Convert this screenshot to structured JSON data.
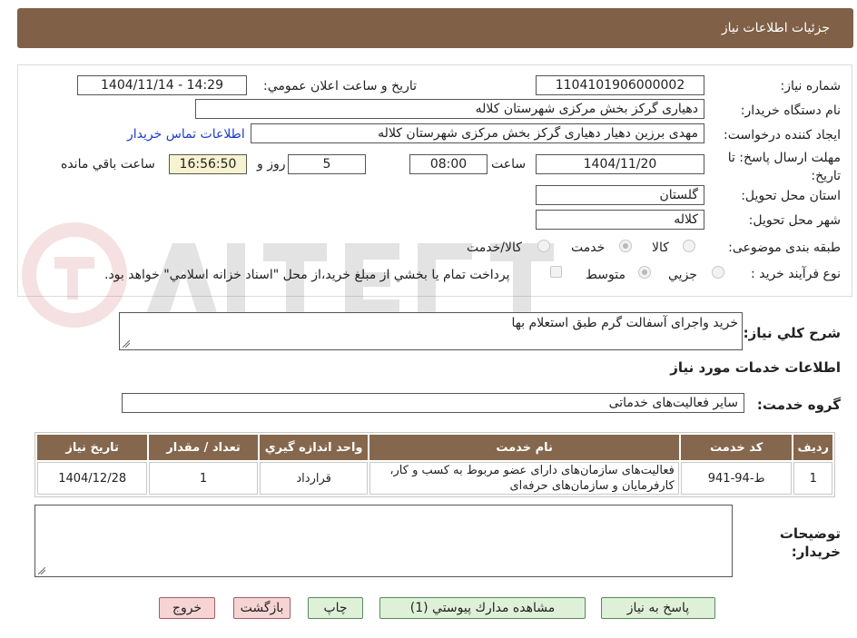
{
  "header": {
    "title": "جزئيات اطلاعات نياز"
  },
  "form": {
    "need_number_label": "شماره نياز:",
    "need_number": "1104101906000002",
    "announce_label": "تاريخ و ساعت اعلان عمومي:",
    "announce_value": "1404/11/14 - 14:29",
    "buyer_org_label": "نام دستگاه خريدار:",
    "buyer_org": "دهیاری گرکز بخش مرکزی شهرستان کلاله",
    "requester_label": "ايجاد كننده درخواست:",
    "requester": "مهدی برزین دهیار دهیاری گرکز بخش مرکزی شهرستان کلاله",
    "contact_link": "اطلاعات تماس خريدار",
    "deadline_label": "مهلت ارسال پاسخ: تا تاريخ:",
    "deadline_date": "1404/11/20",
    "time_label": "ساعت",
    "deadline_time": "08:00",
    "days_value": "5",
    "days_label": "روز و",
    "remaining_time": "16:56:50",
    "remaining_label": "ساعت باقي مانده",
    "province_label": "استان محل تحويل:",
    "province": "گلستان",
    "city_label": "شهر محل تحويل:",
    "city": "کلاله",
    "category_label": "طبقه بندی موضوعی:",
    "category_options": [
      "كالا",
      "خدمت",
      "كالا/خدمت"
    ],
    "category_selected": "خدمت",
    "process_label": "نوع فرآيند خريد :",
    "process_options": [
      "جزيي",
      "متوسط"
    ],
    "process_selected": "متوسط",
    "treasury_note": "پرداخت تمام يا بخشي از مبلغ خريد،از محل \"اسناد خزانه اسلامي\" خواهد بود."
  },
  "description": {
    "label": "شرح كلي نياز:",
    "value": "خرید واجرای آسفالت گرم طبق استعلام بها"
  },
  "services": {
    "section_title": "اطلاعات خدمات مورد نياز",
    "group_label": "گروه خدمت:",
    "group_value": "ساير فعاليت‌هاى خدماتى",
    "columns": [
      "رديف",
      "كد خدمت",
      "نام خدمت",
      "واحد اندازه گيري",
      "تعداد / مقدار",
      "تاريخ نياز"
    ],
    "rows": [
      {
        "row": "1",
        "code": "ط-94-941",
        "name": "فعاليت‌هاى سازمان‌هاى داراى عضو مربوط به كسب و كار، كارفرمايان و سازمان‌هاى حرفه‌اى",
        "unit": "قرارداد",
        "qty": "1",
        "date": "1404/12/28"
      }
    ]
  },
  "notes": {
    "label": "توضيحات خريدار:",
    "value": ""
  },
  "buttons": {
    "reply": "پاسخ به نياز",
    "attachments": "مشاهده مدارك پيوستي (1)",
    "print": "چاپ",
    "back": "بازگشت",
    "exit": "خروج"
  }
}
